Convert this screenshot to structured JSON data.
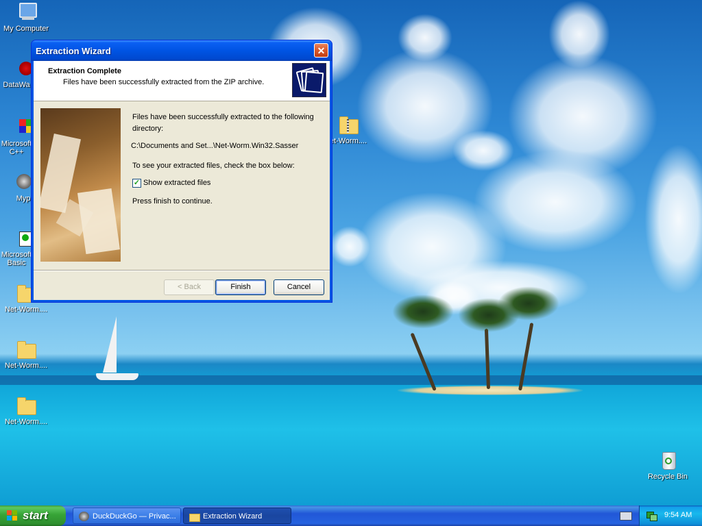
{
  "desktop": {
    "icons": [
      {
        "label": "My Computer",
        "icon": "my-computer-icon"
      },
      {
        "label": "DataWa",
        "icon": "datawatch-icon"
      },
      {
        "label": "Microsoft",
        "label2": "C++",
        "icon": "visual-cpp-icon"
      },
      {
        "label": "Myp",
        "icon": "raccoon-app-icon"
      },
      {
        "label": "Microsoft",
        "label2": "Basic",
        "icon": "visual-basic-icon"
      },
      {
        "label": "Net-Worm....",
        "icon": "folder-icon"
      },
      {
        "label": "Net-Worm....",
        "icon": "folder-icon"
      },
      {
        "label": "Net-Worm....",
        "icon": "folder-icon"
      },
      {
        "label": "et-Worm....",
        "icon": "zip-folder-icon"
      },
      {
        "label": "Recycle Bin",
        "icon": "recycle-bin-icon"
      }
    ]
  },
  "window": {
    "title": "Extraction Wizard",
    "close_label": "✕",
    "header": {
      "title": "Extraction Complete",
      "subtitle": "Files have been successfully extracted from the ZIP archive."
    },
    "body": {
      "line1": "Files have been successfully extracted to the following",
      "line2": "directory:",
      "path": "C:\\Documents and Set...\\Net-Worm.Win32.Sasser",
      "instruction": "To see your extracted files, check the box below:",
      "checkbox_label": "Show extracted files",
      "checkbox_checked": true,
      "finish_note": "Press finish to continue."
    },
    "buttons": {
      "back": "< Back",
      "finish": "Finish",
      "cancel": "Cancel"
    }
  },
  "taskbar": {
    "start_label": "start",
    "tasks": [
      {
        "label": "DuckDuckGo — Privac...",
        "icon": "browser-icon",
        "active": false
      },
      {
        "label": "Extraction Wizard",
        "icon": "folder-icon",
        "active": true
      }
    ],
    "clock": "9:54 AM"
  },
  "colors": {
    "title_bar": "#0054e3",
    "dialog_bg": "#ece9d8",
    "taskbar": "#2157d7",
    "start_button": "#37a437"
  }
}
